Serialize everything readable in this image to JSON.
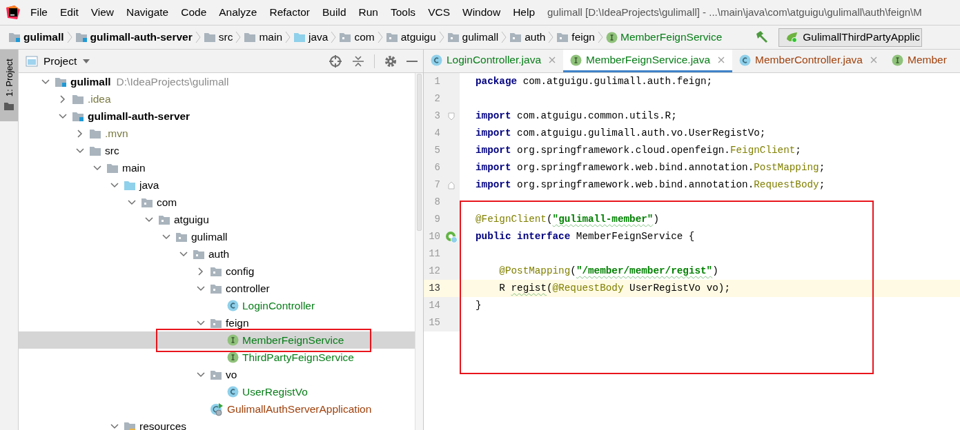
{
  "menu": {
    "items": [
      "File",
      "Edit",
      "View",
      "Navigate",
      "Code",
      "Analyze",
      "Refactor",
      "Build",
      "Run",
      "Tools",
      "VCS",
      "Window",
      "Help"
    ],
    "title": "gulimall [D:\\IdeaProjects\\gulimall] - ...\\main\\java\\com\\atguigu\\gulimall\\auth\\feign\\M"
  },
  "breadcrumb": {
    "items": [
      {
        "label": "gulimall",
        "kind": "module"
      },
      {
        "label": "gulimall-auth-server",
        "kind": "module"
      },
      {
        "label": "src",
        "kind": "folder"
      },
      {
        "label": "main",
        "kind": "folder"
      },
      {
        "label": "java",
        "kind": "source"
      },
      {
        "label": "com",
        "kind": "package"
      },
      {
        "label": "atguigu",
        "kind": "package"
      },
      {
        "label": "gulimall",
        "kind": "package"
      },
      {
        "label": "auth",
        "kind": "package"
      },
      {
        "label": "feign",
        "kind": "package"
      },
      {
        "label": "MemberFeignService",
        "kind": "interface"
      }
    ],
    "run_config": "GulimallThirdPartyApplic"
  },
  "side_stripe": {
    "label": "1: Project"
  },
  "project": {
    "title": "Project",
    "tree": [
      {
        "label": "gulimall",
        "path": "D:\\IdeaProjects\\gulimall",
        "kind": "module",
        "expanded": true,
        "selected": false,
        "children": [
          {
            "label": ".idea",
            "kind": "folder",
            "color": "#7a7a43",
            "expanded": false,
            "selected": false
          },
          {
            "label": "gulimall-auth-server",
            "kind": "module",
            "expanded": true,
            "selected": false,
            "children": [
              {
                "label": ".mvn",
                "kind": "folder",
                "color": "#7a7a43",
                "expanded": false,
                "selected": false
              },
              {
                "label": "src",
                "kind": "folder",
                "expanded": true,
                "selected": false,
                "children": [
                  {
                    "label": "main",
                    "kind": "folder",
                    "expanded": true,
                    "selected": false,
                    "children": [
                      {
                        "label": "java",
                        "kind": "source",
                        "expanded": true,
                        "selected": false,
                        "children": [
                          {
                            "label": "com",
                            "kind": "package",
                            "expanded": true,
                            "selected": false,
                            "children": [
                              {
                                "label": "atguigu",
                                "kind": "package",
                                "expanded": true,
                                "selected": false,
                                "children": [
                                  {
                                    "label": "gulimall",
                                    "kind": "package",
                                    "expanded": true,
                                    "selected": false,
                                    "children": [
                                      {
                                        "label": "auth",
                                        "kind": "package",
                                        "expanded": true,
                                        "selected": false,
                                        "children": [
                                          {
                                            "label": "config",
                                            "kind": "package",
                                            "expanded": false,
                                            "selected": false
                                          },
                                          {
                                            "label": "controller",
                                            "kind": "package",
                                            "expanded": true,
                                            "selected": false,
                                            "children": [
                                              {
                                                "label": "LoginController",
                                                "kind": "class",
                                                "color": "#067d17",
                                                "selected": false
                                              }
                                            ]
                                          },
                                          {
                                            "label": "feign",
                                            "kind": "package",
                                            "expanded": true,
                                            "selected": false,
                                            "children": [
                                              {
                                                "label": "MemberFeignService",
                                                "kind": "interface",
                                                "color": "#067d17",
                                                "selected": true,
                                                "highlighted": true
                                              },
                                              {
                                                "label": "ThirdPartyFeignService",
                                                "kind": "interface",
                                                "color": "#067d17",
                                                "selected": false
                                              }
                                            ]
                                          },
                                          {
                                            "label": "vo",
                                            "kind": "package",
                                            "expanded": true,
                                            "selected": false,
                                            "children": [
                                              {
                                                "label": "UserRegistVo",
                                                "kind": "class",
                                                "color": "#067d17",
                                                "selected": false
                                              }
                                            ]
                                          },
                                          {
                                            "label": "GulimallAuthServerApplication",
                                            "kind": "app",
                                            "color": "#a0410c",
                                            "selected": false
                                          }
                                        ]
                                      }
                                    ]
                                  }
                                ]
                              }
                            ]
                          }
                        ]
                      },
                      {
                        "label": "resources",
                        "kind": "resources",
                        "expanded": true,
                        "selected": false
                      }
                    ]
                  }
                ]
              }
            ]
          }
        ]
      }
    ]
  },
  "editor": {
    "tabs": [
      {
        "label": "LoginController.java",
        "kind": "class",
        "color": "#067d17",
        "selected": false,
        "closable": true
      },
      {
        "label": "MemberFeignService.java",
        "kind": "interface",
        "color": "#067d17",
        "selected": true,
        "closable": true
      },
      {
        "label": "MemberController.java",
        "kind": "class",
        "color": "#a0410c",
        "selected": false,
        "closable": true
      },
      {
        "label": "Member",
        "kind": "interface",
        "color": "#a0410c",
        "selected": false,
        "closable": false
      }
    ],
    "highlight_box": true,
    "lines": [
      {
        "number": "1",
        "current": false,
        "tokens": [
          {
            "kind": "keyword",
            "text": "package"
          },
          {
            "kind": "plain",
            "text": " com.atguigu.gulimall.auth.feign;"
          }
        ]
      },
      {
        "number": "2",
        "current": false
      },
      {
        "number": "3",
        "current": false,
        "kind": "fold-start",
        "tokens": [
          {
            "kind": "keyword",
            "text": "import"
          },
          {
            "kind": "plain",
            "text": " com.atguigu.common.utils.R;"
          }
        ]
      },
      {
        "number": "4",
        "current": false,
        "tokens": [
          {
            "kind": "keyword",
            "text": "import"
          },
          {
            "kind": "plain",
            "text": " com.atguigu.gulimall.auth.vo.UserRegistVo;"
          }
        ]
      },
      {
        "number": "5",
        "current": false,
        "tokens": [
          {
            "kind": "keyword",
            "text": "import"
          },
          {
            "kind": "plain",
            "text": " org.springframework.cloud.openfeign."
          },
          {
            "kind": "annotation",
            "text": "FeignClient"
          },
          {
            "kind": "plain",
            "text": ";"
          }
        ]
      },
      {
        "number": "6",
        "current": false,
        "tokens": [
          {
            "kind": "keyword",
            "text": "import"
          },
          {
            "kind": "plain",
            "text": " org.springframework.web.bind.annotation."
          },
          {
            "kind": "annotation",
            "text": "PostMapping"
          },
          {
            "kind": "plain",
            "text": ";"
          }
        ]
      },
      {
        "number": "7",
        "current": false,
        "kind": "fold-end",
        "tokens": [
          {
            "kind": "keyword",
            "text": "import"
          },
          {
            "kind": "plain",
            "text": " org.springframework.web.bind.annotation."
          },
          {
            "kind": "annotation",
            "text": "RequestBody"
          },
          {
            "kind": "plain",
            "text": ";"
          }
        ]
      },
      {
        "number": "8",
        "current": false
      },
      {
        "number": "9",
        "current": false,
        "tokens": [
          {
            "kind": "annotation",
            "text": "@FeignClient"
          },
          {
            "kind": "plain",
            "text": "("
          },
          {
            "kind": "string",
            "text": "\"gulimall-member\"",
            "typo": true
          },
          {
            "kind": "plain",
            "text": ")"
          }
        ]
      },
      {
        "number": "10",
        "current": false,
        "kind": "implemented",
        "tokens": [
          {
            "kind": "keyword",
            "text": "public interface"
          },
          {
            "kind": "plain",
            "text": " MemberFeignService {"
          }
        ]
      },
      {
        "number": "11",
        "current": false
      },
      {
        "number": "12",
        "current": false,
        "indented": true,
        "tokens": [
          {
            "kind": "annotation",
            "text": "@PostMapping"
          },
          {
            "kind": "plain",
            "text": "("
          },
          {
            "kind": "string",
            "text": "\"/member/member/regist\"",
            "typo": true
          },
          {
            "kind": "plain",
            "text": ")"
          }
        ]
      },
      {
        "number": "13",
        "current": true,
        "indented": true,
        "tokens": [
          {
            "kind": "plain",
            "text": "R "
          },
          {
            "kind": "plain",
            "text": "regist",
            "typo": true
          },
          {
            "kind": "plain",
            "text": "("
          },
          {
            "kind": "annotation",
            "text": "@RequestBody"
          },
          {
            "kind": "plain",
            "text": " UserRegistVo vo);"
          }
        ]
      },
      {
        "number": "14",
        "current": false,
        "tokens": [
          {
            "kind": "plain",
            "text": "}"
          }
        ]
      },
      {
        "number": "15",
        "current": false
      }
    ]
  }
}
